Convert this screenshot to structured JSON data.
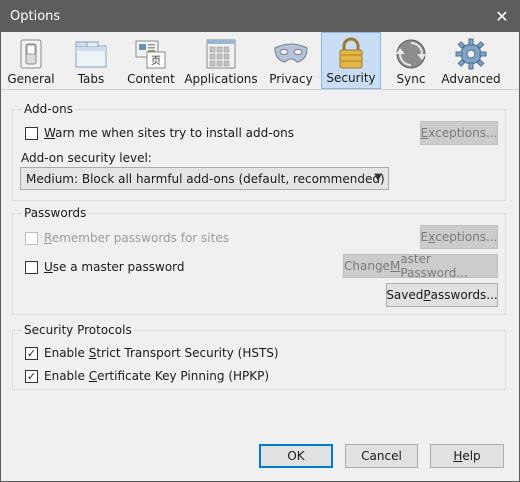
{
  "window": {
    "title": "Options"
  },
  "tabs": [
    {
      "label": "General",
      "icon": "switch-icon"
    },
    {
      "label": "Tabs",
      "icon": "tabs-icon"
    },
    {
      "label": "Content",
      "icon": "content-icon"
    },
    {
      "label": "Applications",
      "icon": "applications-icon"
    },
    {
      "label": "Privacy",
      "icon": "mask-icon"
    },
    {
      "label": "Security",
      "icon": "padlock-icon",
      "selected": true
    },
    {
      "label": "Sync",
      "icon": "sync-icon"
    },
    {
      "label": "Advanced",
      "icon": "gear-icon"
    }
  ],
  "addons": {
    "title": "Add-ons",
    "warn_label": "Warn me when sites try to install add-ons",
    "warn_checked": false,
    "exceptions_label": "Exceptions...",
    "security_level_label": "Add-on security level:",
    "security_level_value": "Medium: Block all harmful add-ons (default, recommended)"
  },
  "passwords": {
    "title": "Passwords",
    "remember_label": "Remember passwords for sites",
    "remember_checked": false,
    "exceptions_label": "Exceptions...",
    "master_label": "Use a master password",
    "master_checked": false,
    "change_master_label": "Change Master Password...",
    "saved_label": "Saved Passwords..."
  },
  "protocols": {
    "title": "Security Protocols",
    "hsts_label": "Enable Strict Transport Security (HSTS)",
    "hsts_checked": true,
    "hpkp_label": "Enable Certificate Key Pinning (HPKP)",
    "hpkp_checked": true
  },
  "footer": {
    "ok_label": "OK",
    "cancel_label": "Cancel",
    "help_label": "Help"
  },
  "colors": {
    "titlebar": "#5d5d5d",
    "selected_tab": "#c9def5",
    "accent": "#0078d7"
  }
}
